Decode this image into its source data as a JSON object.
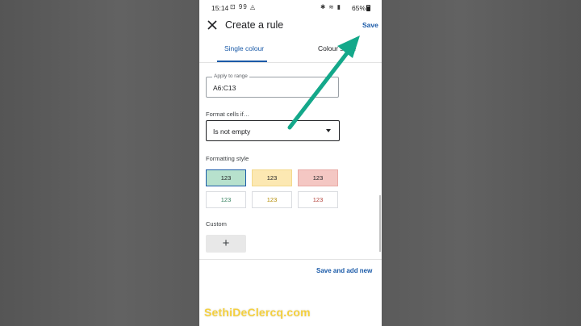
{
  "status_bar": {
    "time": "15:14",
    "left_icons": "⊡ 99 ◬",
    "right_icons": "✱ ≋ ▮",
    "battery": "65%"
  },
  "header": {
    "title": "Create a rule",
    "save_label": "Save"
  },
  "tabs": [
    {
      "label": "Single colour",
      "active": true
    },
    {
      "label": "Colour scale",
      "active": false
    }
  ],
  "range": {
    "label": "Apply to range",
    "value": "A6:C13"
  },
  "format": {
    "label": "Format cells if…",
    "selected": "Is not empty"
  },
  "formatting_style": {
    "label": "Formatting style",
    "swatches": [
      "123",
      "123",
      "123",
      "123",
      "123",
      "123"
    ]
  },
  "custom": {
    "label": "Custom",
    "add_label": "+"
  },
  "footer": {
    "save_new_label": "Save and add new"
  },
  "watermark": "SethiDeClercq.com",
  "colors": {
    "accent": "#1a5aa8",
    "arrow": "#14a88a",
    "watermark": "#f4d03f"
  }
}
